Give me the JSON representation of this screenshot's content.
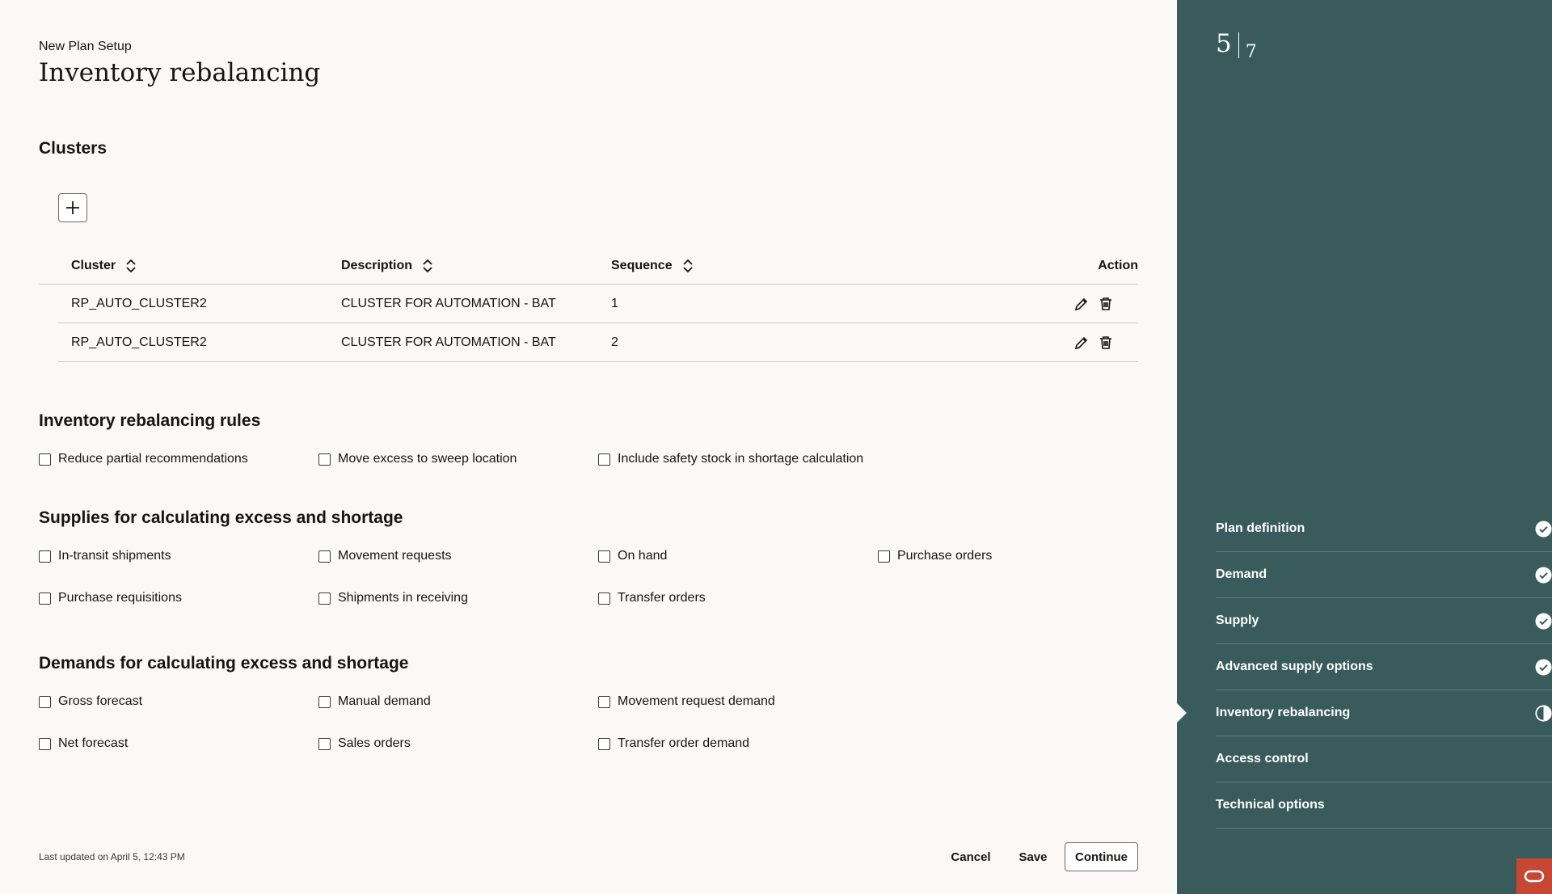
{
  "header": {
    "eyebrow": "New Plan Setup",
    "title": "Inventory rebalancing"
  },
  "clusters": {
    "title": "Clusters",
    "columns": {
      "cluster": "Cluster",
      "description": "Description",
      "sequence": "Sequence",
      "action": "Action"
    },
    "rows": [
      {
        "cluster": "RP_AUTO_CLUSTER2",
        "description": "CLUSTER FOR AUTOMATION - BAT",
        "sequence": "1"
      },
      {
        "cluster": "RP_AUTO_CLUSTER2",
        "description": "CLUSTER FOR AUTOMATION - BAT",
        "sequence": "2"
      }
    ]
  },
  "rules": {
    "title": "Inventory rebalancing rules",
    "items": [
      "Reduce partial recommendations",
      "Move excess to sweep location",
      "Include safety stock in shortage calculation"
    ]
  },
  "supplies": {
    "title": "Supplies for calculating excess and shortage",
    "items": [
      "In-transit shipments",
      "Movement requests",
      "On hand",
      "Purchase orders",
      "Purchase requisitions",
      "Shipments in receiving",
      "Transfer orders"
    ]
  },
  "demands": {
    "title": "Demands for calculating excess and shortage",
    "items": [
      "Gross forecast",
      "Manual demand",
      "Movement request demand",
      "Net forecast",
      "Sales orders",
      "Transfer order demand"
    ]
  },
  "footer": {
    "last_updated": "Last updated on April 5, 12:43 PM",
    "cancel": "Cancel",
    "save": "Save",
    "continue": "Continue"
  },
  "progress": {
    "current": "5",
    "total": "7"
  },
  "steps": [
    {
      "label": "Plan definition",
      "status": "complete"
    },
    {
      "label": "Demand",
      "status": "complete"
    },
    {
      "label": "Supply",
      "status": "complete"
    },
    {
      "label": "Advanced supply options",
      "status": "complete"
    },
    {
      "label": "Inventory rebalancing",
      "status": "in-progress"
    },
    {
      "label": "Access control",
      "status": "not-started"
    },
    {
      "label": "Technical options",
      "status": "not-started"
    }
  ],
  "colors": {
    "sidebar": "#3a5b5c",
    "brand": "#c74634",
    "background": "#faf9f8"
  }
}
